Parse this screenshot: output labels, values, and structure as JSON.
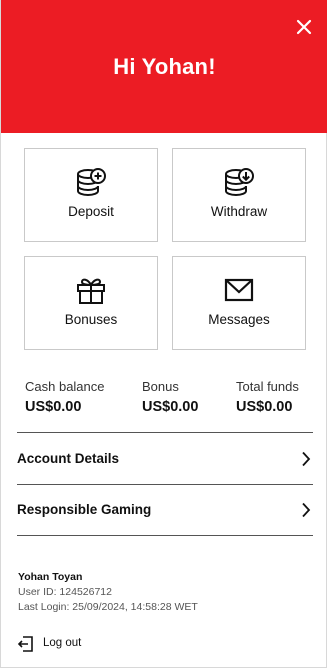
{
  "header": {
    "greeting": "Hi Yohan!",
    "background_color": "#ec1c24",
    "close_icon": "close-icon"
  },
  "actions": [
    {
      "label": "Deposit",
      "icon": "coin-stack-plus-icon"
    },
    {
      "label": "Withdraw",
      "icon": "coin-stack-down-arrow-icon"
    },
    {
      "label": "Bonuses",
      "icon": "gift-icon"
    },
    {
      "label": "Messages",
      "icon": "envelope-icon"
    }
  ],
  "balances": {
    "cash": {
      "label": "Cash balance",
      "value": "US$0.00"
    },
    "bonus": {
      "label": "Bonus",
      "value": "US$0.00"
    },
    "total": {
      "label": "Total funds",
      "value": "US$0.00"
    }
  },
  "menu": [
    {
      "label": "Account Details",
      "icon": "chevron-right-icon"
    },
    {
      "label": "Responsible Gaming",
      "icon": "chevron-right-icon"
    }
  ],
  "user": {
    "name": "Yohan Toyan",
    "user_id": "User ID: 124526712",
    "last_login": "Last Login: 25/09/2024, 14:58:28 WET"
  },
  "logout": {
    "label": "Log out",
    "icon": "logout-icon"
  }
}
